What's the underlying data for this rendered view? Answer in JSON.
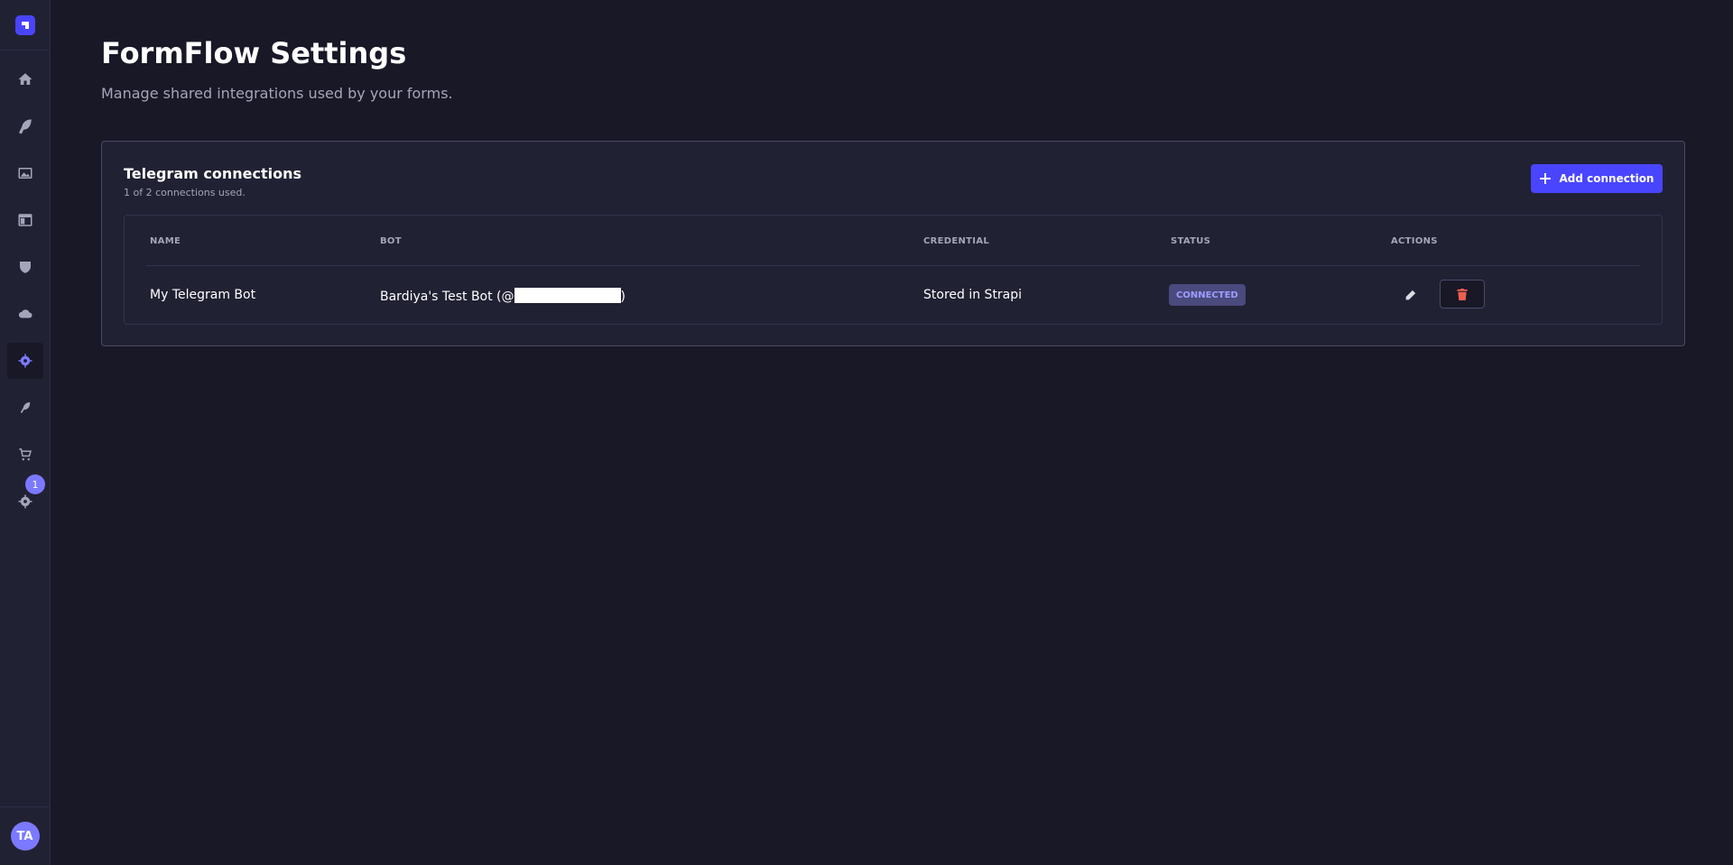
{
  "page": {
    "title": "FormFlow Settings",
    "subtitle": "Manage shared integrations used by your forms."
  },
  "sidebar": {
    "items": [
      {
        "name": "home-icon"
      },
      {
        "name": "feather-icon"
      },
      {
        "name": "media-icon"
      },
      {
        "name": "layout-icon"
      },
      {
        "name": "shield-icon"
      },
      {
        "name": "cloud-icon"
      },
      {
        "name": "gear-icon",
        "active": true
      },
      {
        "name": "puzzle-icon"
      },
      {
        "name": "cart-icon"
      },
      {
        "name": "settings-icon",
        "badge": "1"
      }
    ],
    "user_initials": "TA"
  },
  "connections": {
    "title": "Telegram connections",
    "usage": "1 of 2 connections used.",
    "add_label": "Add connection",
    "columns": [
      "NAME",
      "BOT",
      "CREDENTIAL",
      "STATUS",
      "ACTIONS"
    ],
    "rows": [
      {
        "name": "My Telegram Bot",
        "bot_prefix": "Bardiya's Test Bot (@",
        "bot_suffix": ")",
        "credential": "Stored in Strapi",
        "status": "CONNECTED"
      }
    ]
  },
  "colors": {
    "accent": "#4945ff",
    "background": "#181826",
    "surface": "#212134",
    "danger": "#ee5e52"
  }
}
